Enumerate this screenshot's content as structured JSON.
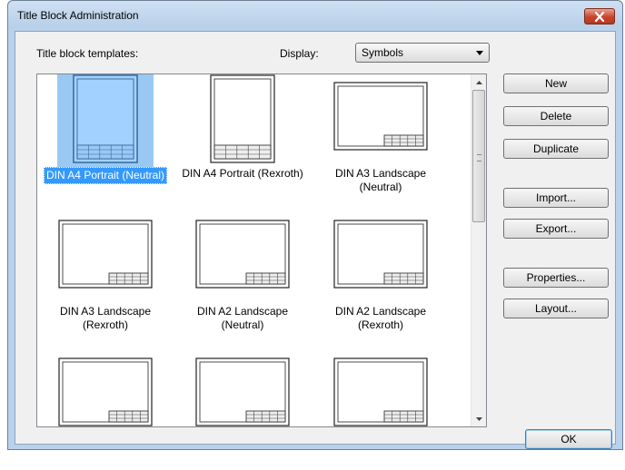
{
  "window": {
    "title": "Title Block Administration",
    "close_icon": "close-icon"
  },
  "labels": {
    "templates": "Title block templates:",
    "display": "Display:"
  },
  "display_select": {
    "value": "Symbols"
  },
  "items": [
    {
      "line1": "DIN A4 Portrait (Neutral)",
      "line2": "",
      "orientation": "portrait",
      "selected": true
    },
    {
      "line1": "DIN A4 Portrait (Rexroth)",
      "line2": "",
      "orientation": "portrait",
      "selected": false
    },
    {
      "line1": "DIN A3 Landscape",
      "line2": "(Neutral)",
      "orientation": "landscape",
      "selected": false
    },
    {
      "line1": "DIN A3 Landscape",
      "line2": "(Rexroth)",
      "orientation": "landscape",
      "selected": false
    },
    {
      "line1": "DIN A2 Landscape",
      "line2": "(Neutral)",
      "orientation": "landscape",
      "selected": false
    },
    {
      "line1": "DIN A2 Landscape",
      "line2": "(Rexroth)",
      "orientation": "landscape",
      "selected": false
    }
  ],
  "buttons": {
    "new": "New",
    "delete": "Delete",
    "duplicate": "Duplicate",
    "import": "Import...",
    "export": "Export...",
    "properties": "Properties...",
    "layout": "Layout...",
    "ok": "OK"
  },
  "colors": {
    "selection": "#3399ff",
    "selection_bg": "#99c9f3",
    "frame": "#6b7f96"
  }
}
